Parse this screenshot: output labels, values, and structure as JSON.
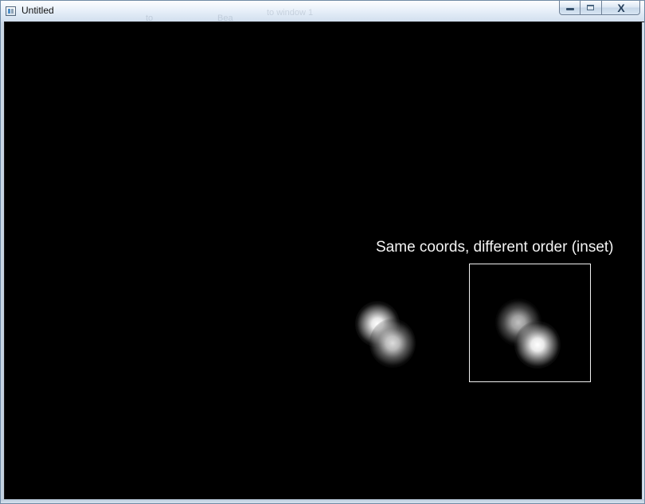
{
  "window": {
    "title": "Untitled",
    "background_text": {
      "partial_label_1": "to",
      "partial_label_2": "Bea",
      "partial_label_3": "to window 1"
    }
  },
  "caption_buttons": {
    "minimize_icon": "minimize-icon",
    "maximize_icon": "maximize-icon",
    "close_icon": "close-icon",
    "close_glyph": "X"
  },
  "canvas": {
    "background_color": "#000000",
    "label": "Same coords, different order (inset)",
    "label_color": "#f4f4f4",
    "frame_color": "#f0f0f0",
    "main_blob_order": [
      "brighter upper-left",
      "dimmer lower-right"
    ],
    "inset_blob_order": [
      "dimmer upper-left",
      "brighter lower-right"
    ]
  }
}
